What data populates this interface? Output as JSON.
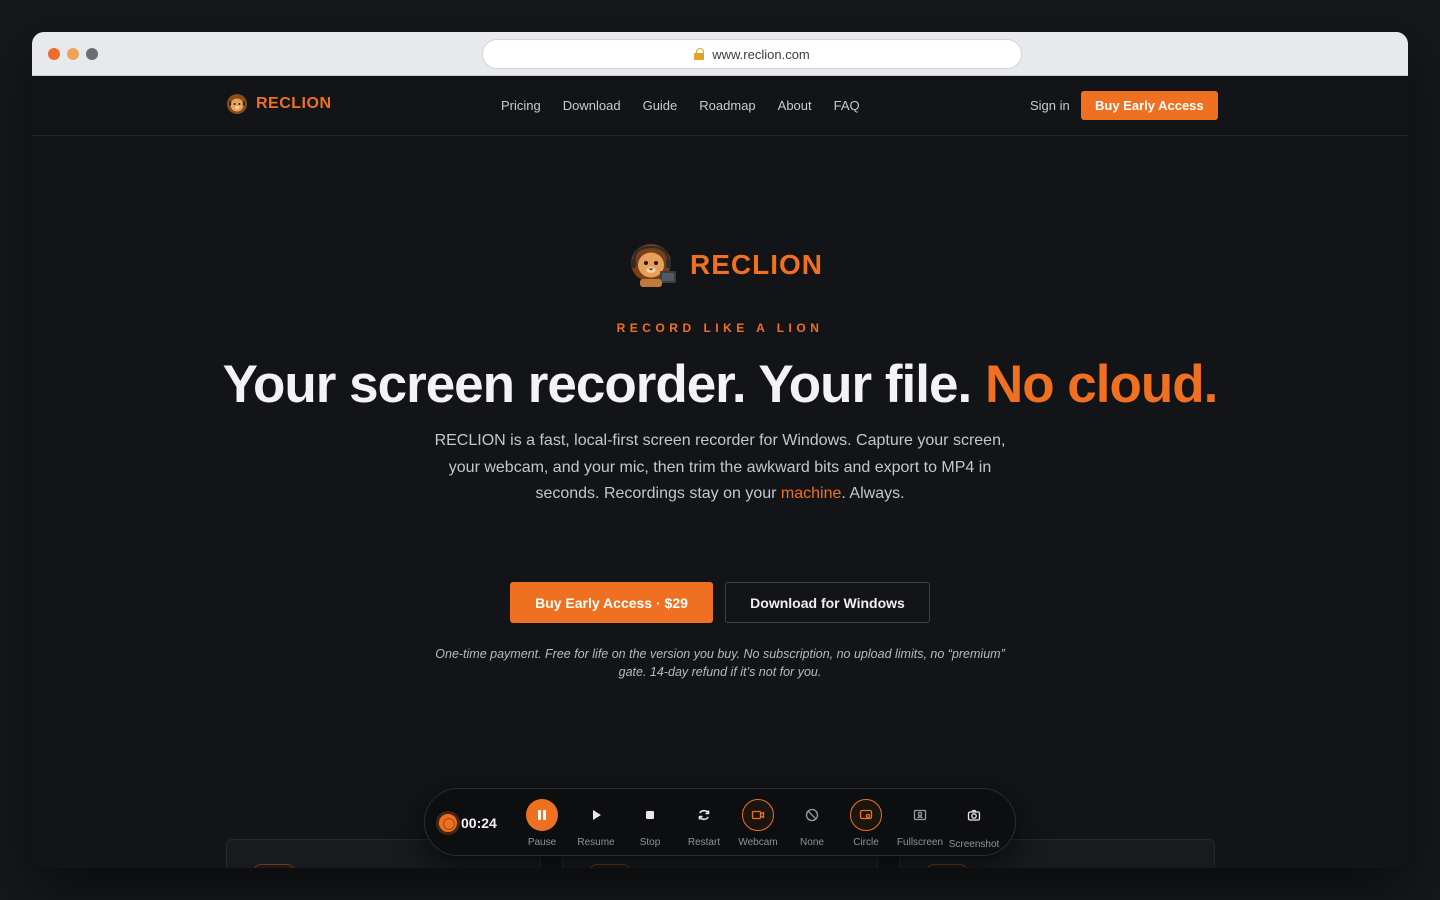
{
  "browser": {
    "url": "www.reclion.com"
  },
  "nav": {
    "brand": "RECLION",
    "links": [
      "Pricing",
      "Download",
      "Guide",
      "Roadmap",
      "About",
      "FAQ"
    ],
    "signin": "Sign in",
    "cta": "Buy Early Access"
  },
  "hero": {
    "logo_text": "RECLION",
    "eyebrow": "RECORD LIKE A LION",
    "headline_main": "Your screen recorder. Your file.",
    "headline_accent": "No cloud.",
    "lede_1": "RECLION is a fast, local-first screen recorder for Windows. Capture your screen, your webcam, and your mic, then trim the awkward bits and export to MP4 in seconds. Recordings stay on your",
    "lede_highlight": "machine",
    "lede_2": ". Always.",
    "cta_primary": "Buy Early Access · $29",
    "cta_secondary": "Download for Windows",
    "fine_print": "One-time payment. Free for life on the version you buy. No subscription, no upload limits, no “premium” gate. 14-day refund if it’s not for you."
  },
  "toolbar": {
    "timer": "00:24",
    "buttons": [
      {
        "label": "Pause",
        "icon": "pause-icon"
      },
      {
        "label": "Resume",
        "icon": "play-icon"
      },
      {
        "label": "Stop",
        "icon": "stop-icon"
      },
      {
        "label": "Restart",
        "icon": "restart-icon"
      },
      {
        "label": "Webcam",
        "icon": "webcam-icon"
      },
      {
        "label": "None",
        "icon": "none-icon"
      },
      {
        "label": "Circle",
        "icon": "circle-cam-icon"
      },
      {
        "label": "Fullscreen",
        "icon": "fullscreen-icon"
      },
      {
        "label": "Screenshot",
        "icon": "camera-icon"
      }
    ]
  },
  "features": [
    {
      "icon": "lion-icon"
    },
    {
      "icon": "sparkle-icon"
    },
    {
      "icon": "dollar-icon"
    }
  ],
  "colors": {
    "accent": "#f07021",
    "background": "#121417"
  }
}
